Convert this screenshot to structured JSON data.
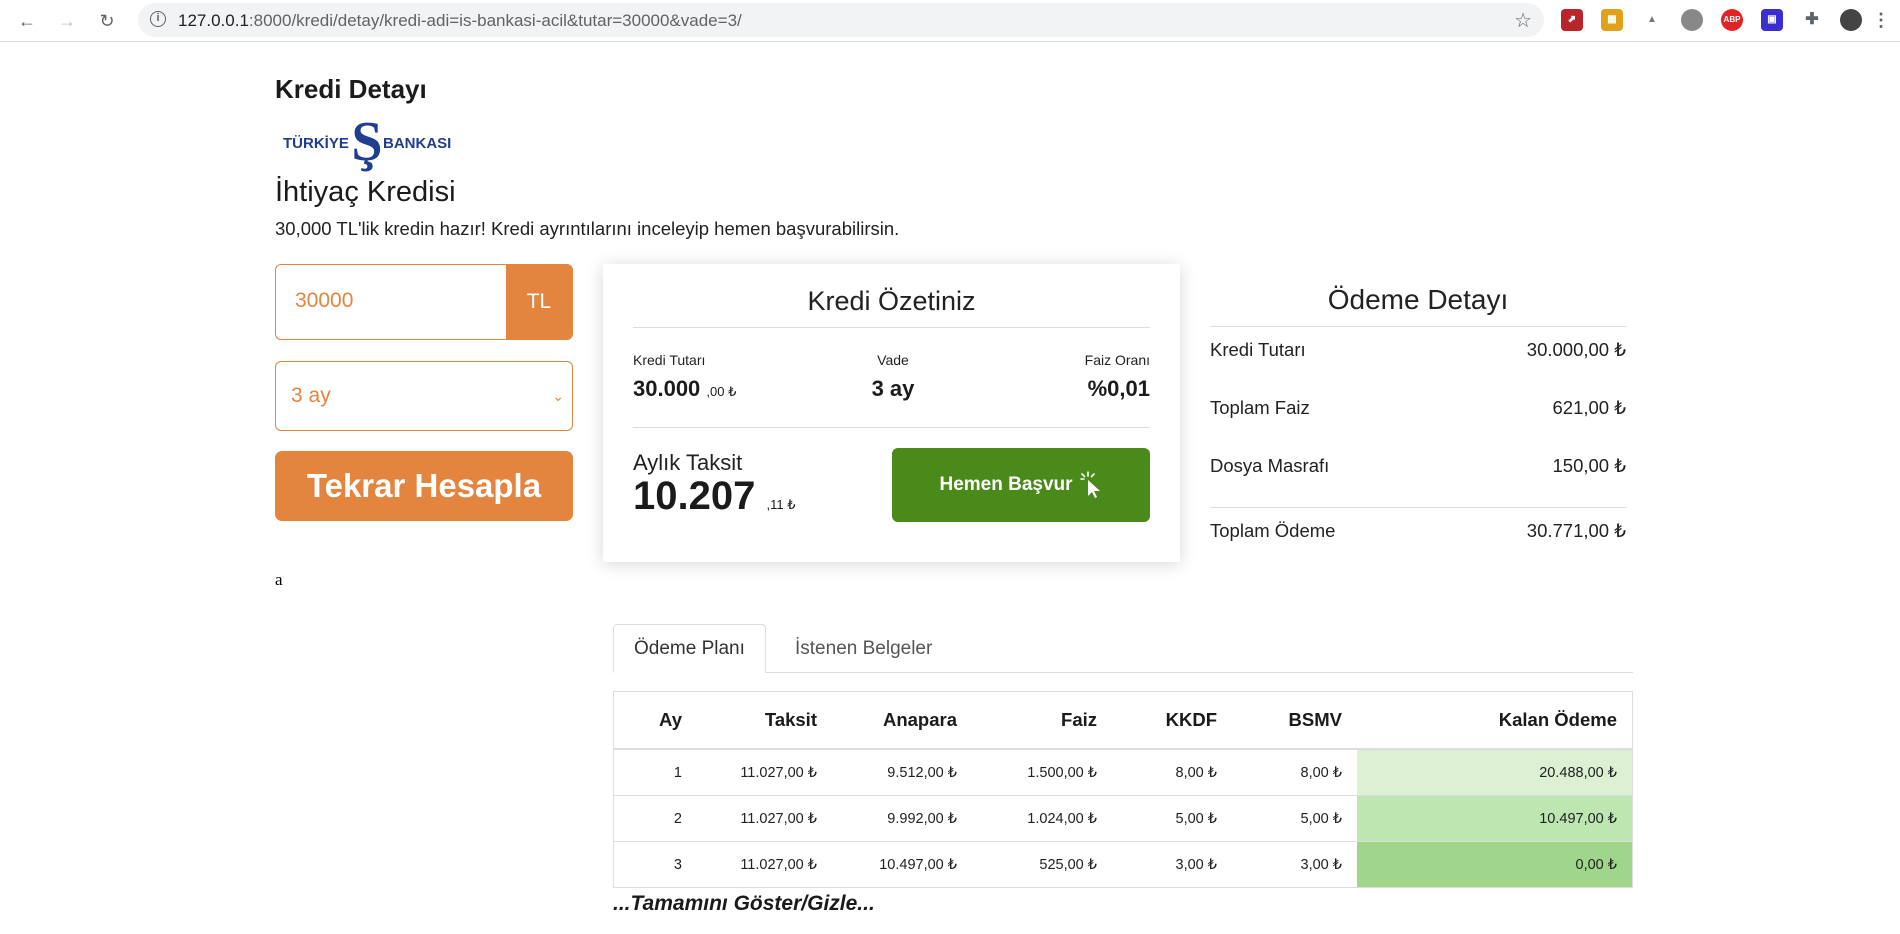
{
  "browser": {
    "url_host": "127.0.0.1",
    "url_path": ":8000/kredi/detay/kredi-adi=is-bankasi-acil&tutar=30000&vade=3/"
  },
  "page": {
    "title": "Kredi Detayı",
    "bank_logo_left": "TÜRKİYE",
    "bank_logo_right": "BANKASI",
    "subtitle": "İhtiyaç Kredisi",
    "description": "30,000 TL'lik kredin hazır! Kredi ayrıntılarını inceleyip hemen başvurabilirsin.",
    "stray_text": "a"
  },
  "form": {
    "amount_value": "30000",
    "amount_unit": "TL",
    "term_value": "3 ay",
    "calc_button": "Tekrar Hesapla"
  },
  "summary": {
    "title": "Kredi Özetiniz",
    "amount_label": "Kredi Tutarı",
    "amount_main": "30.000",
    "amount_decimal": ",00 ₺",
    "term_label": "Vade",
    "term_value": "3 ay",
    "rate_label": "Faiz Oranı",
    "rate_value": "%0,01",
    "monthly_label": "Aylık Taksit",
    "monthly_main": "10.207",
    "monthly_decimal": ",11 ₺",
    "apply_button": "Hemen Başvur"
  },
  "payment_detail": {
    "title": "Ödeme Detayı",
    "rows": [
      {
        "label": "Kredi Tutarı",
        "value": "30.000,00 ₺"
      },
      {
        "label": "Toplam Faiz",
        "value": "621,00 ₺"
      },
      {
        "label": "Dosya Masrafı",
        "value": "150,00 ₺"
      },
      {
        "label": "Toplam Ödeme",
        "value": "30.771,00 ₺"
      }
    ]
  },
  "tabs": [
    "Ödeme Planı",
    "İstenen Belgeler"
  ],
  "plan_table": {
    "headers": [
      "Ay",
      "Taksit",
      "Anapara",
      "Faiz",
      "KKDF",
      "BSMV",
      "Kalan Ödeme"
    ],
    "rows": [
      [
        "1",
        "11.027,00 ₺",
        "9.512,00 ₺",
        "1.500,00 ₺",
        "8,00 ₺",
        "8,00 ₺",
        "20.488,00 ₺"
      ],
      [
        "2",
        "11.027,00 ₺",
        "9.992,00 ₺",
        "1.024,00 ₺",
        "5,00 ₺",
        "5,00 ₺",
        "10.497,00 ₺"
      ],
      [
        "3",
        "11.027,00 ₺",
        "10.497,00 ₺",
        "525,00 ₺",
        "3,00 ₺",
        "3,00 ₺",
        "0,00 ₺"
      ]
    ]
  },
  "toggle_link": "...Tamamını Göster/Gizle...",
  "colors": {
    "accent_orange": "#e3843f",
    "apply_green": "#498a1b",
    "bank_blue": "#1f3e8f"
  }
}
